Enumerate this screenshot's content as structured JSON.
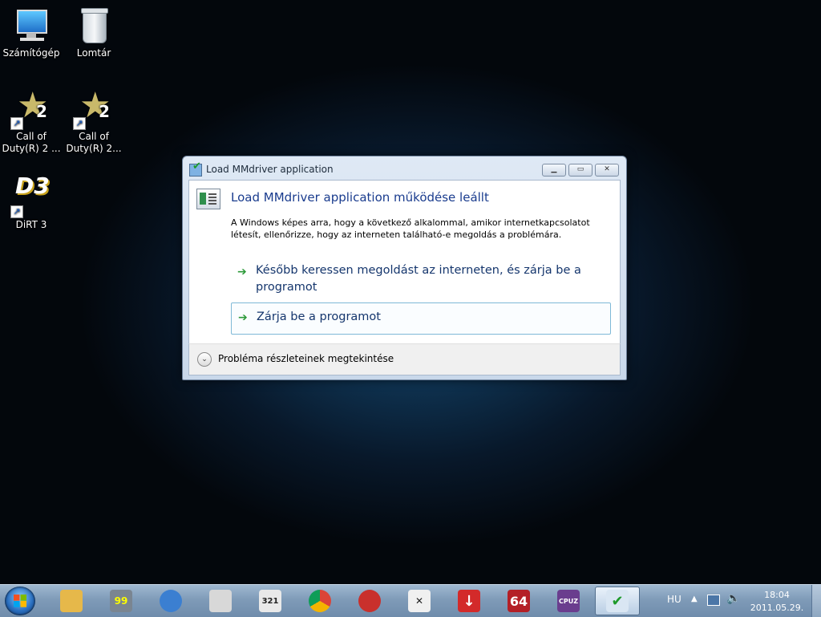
{
  "desktop": {
    "icons": [
      {
        "label_1": "Számítógép",
        "label_2": "",
        "icon": "computer-icon"
      },
      {
        "label_1": "Lomtár",
        "label_2": "",
        "icon": "recycle-bin-icon"
      },
      {
        "label_1": "Call of",
        "label_2": "Duty(R) 2 ...",
        "icon": "call-of-duty-2-icon"
      },
      {
        "label_1": "Call of",
        "label_2": "Duty(R) 2...",
        "icon": "call-of-duty-2-icon"
      },
      {
        "label_1": "DiRT 3",
        "label_2": "",
        "icon": "dirt3-icon"
      }
    ]
  },
  "dialog": {
    "title": "Load MMdriver application",
    "heading": "Load MMdriver application működése leállt",
    "description": "A Windows képes arra, hogy a következő alkalommal, amikor internetkapcsolatot létesít, ellenőrizze, hogy az interneten található-e megoldás a problémára.",
    "option_online": "Később keressen megoldást az interneten, és zárja be a programot",
    "option_close": "Zárja be a programot",
    "details_label": "Probléma részleteinek megtekintése",
    "icon_cod_badge": "2",
    "icon_dirt_badge": "D3"
  },
  "taskbar": {
    "buttons": [
      {
        "icon": "explorer-folder-icon",
        "color": "#e6b84a",
        "glyph": ""
      },
      {
        "icon": "monitor-99-icon",
        "color": "#7a8591",
        "glyph": "99"
      },
      {
        "icon": "disc-burner-icon",
        "color": "#3b7fd1",
        "glyph": ""
      },
      {
        "icon": "wolf-mask-icon",
        "color": "#d8d8d8",
        "glyph": ""
      },
      {
        "icon": "media-player-classic-icon",
        "color": "#e9e9e9",
        "glyph": "321"
      },
      {
        "icon": "chrome-icon",
        "color": "#4a9d4a",
        "glyph": ""
      },
      {
        "icon": "flame-app-icon",
        "color": "#c9302c",
        "glyph": ""
      },
      {
        "icon": "cross-tool-icon",
        "color": "#f0f0f0",
        "glyph": ""
      },
      {
        "icon": "download-arrow-icon",
        "color": "#d32a2a",
        "glyph": "↓"
      },
      {
        "icon": "aida64-icon",
        "color": "#b41f26",
        "glyph": "64"
      },
      {
        "icon": "cpu-z-icon",
        "color": "#6a3d8e",
        "glyph": "CPUZ"
      },
      {
        "icon": "problem-reporting-icon",
        "color": "#d9e6f3",
        "glyph": "✔"
      }
    ],
    "language": "HU",
    "time": "18:04",
    "date": "2011.05.29."
  }
}
